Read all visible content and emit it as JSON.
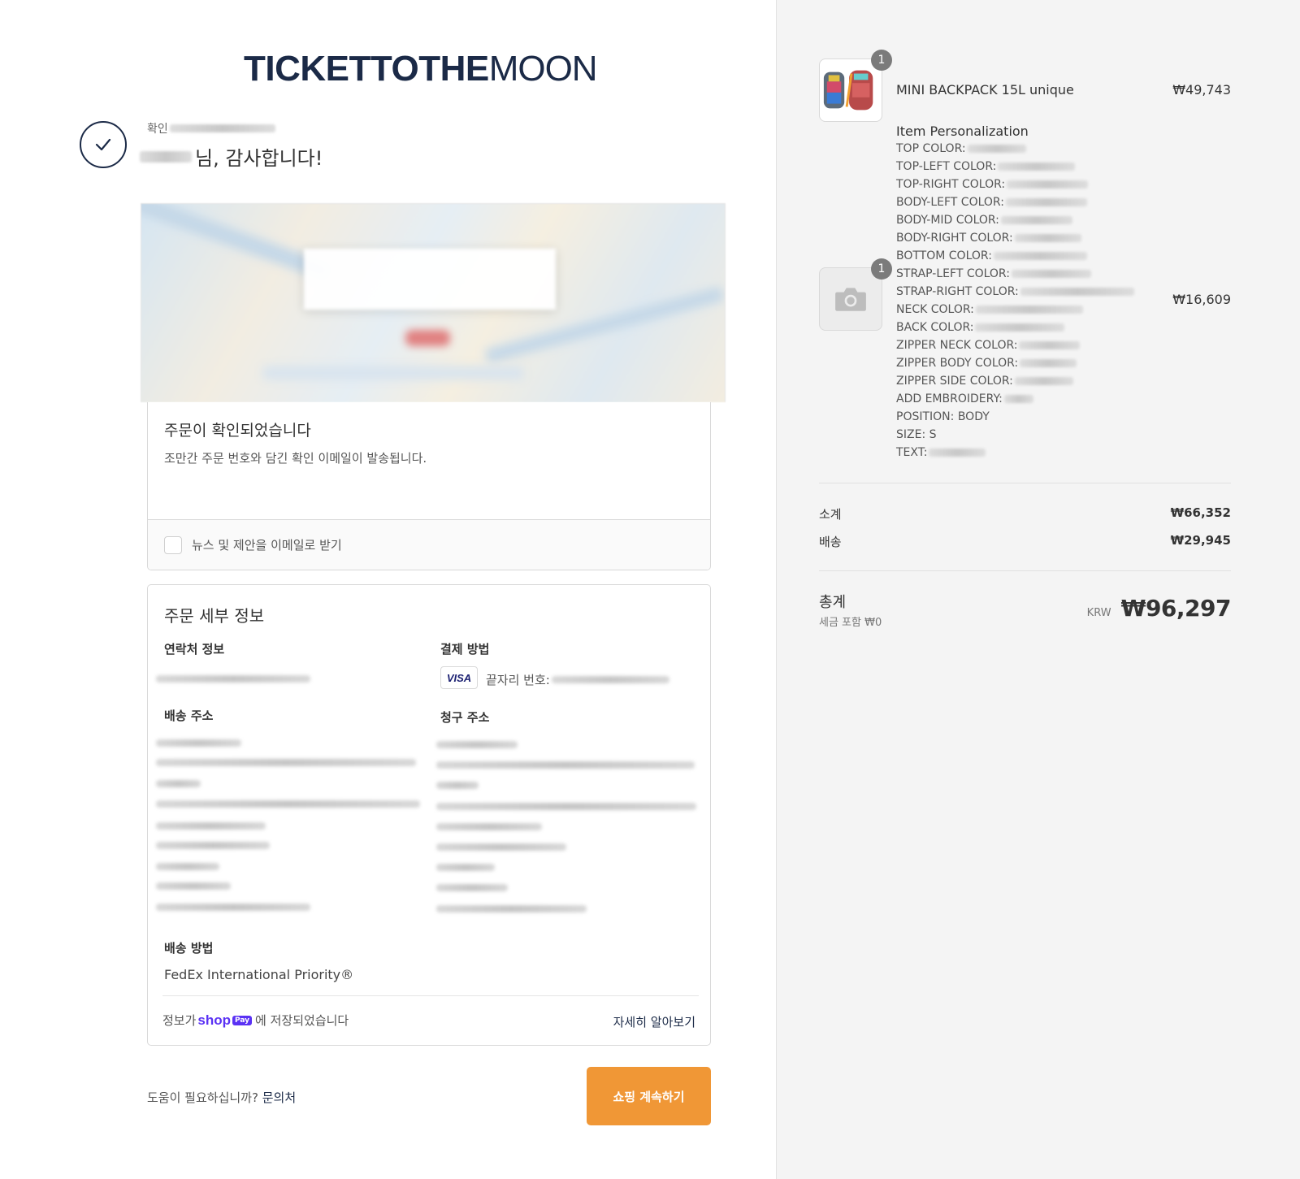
{
  "brand": {
    "logo_bold": "TICKET",
    "logo_mid": "TOTHE",
    "logo_light": "MOON"
  },
  "header": {
    "confirm_label": "확인",
    "thanks": "님, 감사합니다!"
  },
  "order_confirmed": {
    "title": "주문이 확인되었습니다",
    "message": "조만간 주문 번호와 담긴 확인 이메일이 발송됩니다.",
    "newsletter_label": "뉴스 및 제안을 이메일로 받기",
    "newsletter_checked": false
  },
  "details": {
    "title": "주문 세부 정보",
    "contact_label": "연락처 정보",
    "payment_label": "결제 방법",
    "card_brand": "VISA",
    "last_digits_label": "끝자리 번호:",
    "shipping_address_label": "배송 주소",
    "billing_address_label": "청구 주소",
    "shipping_method_label": "배송 방법",
    "shipping_method": "FedEx International Priority®",
    "shoppay_prefix": "정보가",
    "shoppay_shop": "shop",
    "shoppay_pay": "Pay",
    "shoppay_suffix": "에 저장되었습니다",
    "learn_more": "자세히 알아보기"
  },
  "footer": {
    "help_text": "도움이 필요하십니까?",
    "contact_link": "문의처",
    "continue_button": "쇼핑 계속하기"
  },
  "cart": {
    "items": [
      {
        "name": "MINI BACKPACK 15L unique",
        "price": "₩49,743",
        "qty": "1"
      },
      {
        "name": "",
        "price": "₩16,609",
        "qty": "1"
      }
    ],
    "personalization_title": "Item Personalization",
    "attributes": [
      "TOP COLOR:",
      "TOP-LEFT COLOR:",
      "TOP-RIGHT COLOR:",
      "BODY-LEFT COLOR:",
      "BODY-MID COLOR:",
      "BODY-RIGHT COLOR:",
      "BOTTOM COLOR:",
      "STRAP-LEFT COLOR:",
      "STRAP-RIGHT COLOR:",
      "NECK COLOR:",
      "BACK COLOR:",
      "ZIPPER NECK COLOR:",
      "ZIPPER BODY COLOR:",
      "ZIPPER SIDE COLOR:",
      "ADD EMBROIDERY:",
      "POSITION: BODY",
      "SIZE: S",
      "TEXT:"
    ]
  },
  "summary": {
    "subtotal_label": "소계",
    "subtotal": "₩66,352",
    "shipping_label": "배송",
    "shipping": "₩29,945",
    "total_label": "총계",
    "tax_note": "세금 포함 ₩0",
    "currency": "KRW",
    "total": "₩96,297"
  },
  "colors": {
    "brand_navy": "#1b2a47",
    "cta_orange": "#f09736",
    "shoppay_purple": "#5a31f4"
  },
  "icons": {
    "confirm": "check-circle-icon",
    "placeholder": "camera-icon"
  }
}
